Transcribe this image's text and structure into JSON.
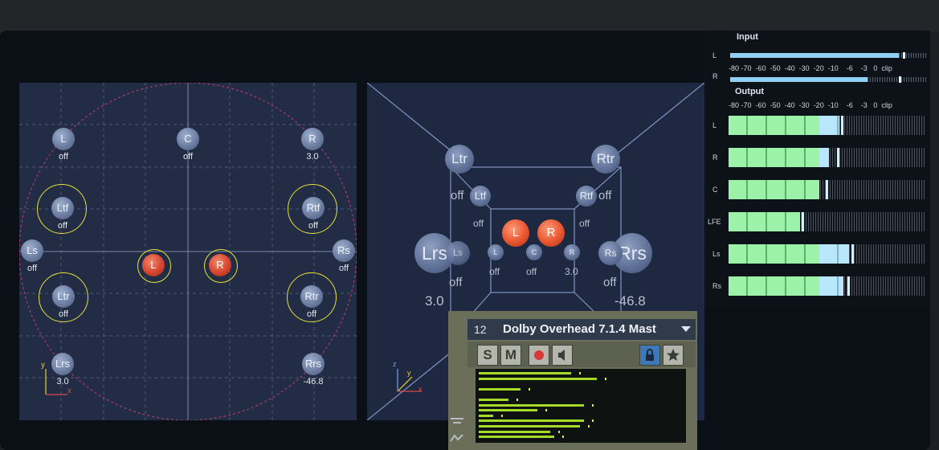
{
  "panner2d": {
    "speakers": [
      {
        "id": "L",
        "label": "L",
        "value": "off"
      },
      {
        "id": "C",
        "label": "C",
        "value": "off"
      },
      {
        "id": "R",
        "label": "R",
        "value": "3.0"
      },
      {
        "id": "Ltf",
        "label": "Ltf",
        "value": "off"
      },
      {
        "id": "Rtf",
        "label": "Rtf",
        "value": "off"
      },
      {
        "id": "Ls",
        "label": "Ls",
        "value": "off"
      },
      {
        "id": "Rs",
        "label": "Rs",
        "value": "off"
      },
      {
        "id": "Ltr",
        "label": "Ltr",
        "value": "off"
      },
      {
        "id": "Rtr",
        "label": "Rtr",
        "value": "off"
      },
      {
        "id": "Lrs",
        "label": "Lrs",
        "value": "3.0"
      },
      {
        "id": "Rrs",
        "label": "Rrs",
        "value": "-46.8"
      }
    ],
    "sources": [
      {
        "id": "L",
        "label": "L"
      },
      {
        "id": "R",
        "label": "R"
      }
    ],
    "axes": {
      "y": "y",
      "x": "x"
    }
  },
  "room3d": {
    "top_speakers": [
      {
        "label": "Ltr"
      },
      {
        "label": "Rtr"
      },
      {
        "label": "Ltf"
      },
      {
        "label": "Rtf"
      }
    ],
    "side_speakers": [
      {
        "label": "Lrs"
      },
      {
        "label": "Rrs"
      },
      {
        "label": "Ls"
      },
      {
        "label": "Rs"
      }
    ],
    "front_speakers": [
      {
        "label": "L"
      },
      {
        "label": "C"
      },
      {
        "label": "R"
      }
    ],
    "sources": [
      {
        "label": "L"
      },
      {
        "label": "R"
      }
    ],
    "values": {
      "ltr_off": "off",
      "ltf_off": "off",
      "rtf_off": "off",
      "rtr_off": "off",
      "ls_off": "off",
      "rs_off": "off",
      "l_off": "off",
      "c_off": "off",
      "r_val": "3.0",
      "lrs_val": "3.0",
      "rrs_val": "-46.8"
    },
    "axes": {
      "z": "z",
      "y": "y",
      "x": "x"
    }
  },
  "meters": {
    "input_title": "Input",
    "output_title": "Output",
    "scale": [
      "-80",
      "-70",
      "-60",
      "-50",
      "-40",
      "-30",
      "-20",
      "-10",
      "-6",
      "-3",
      "0",
      "clip"
    ],
    "input_channels": [
      {
        "label": "L",
        "level": 0.86,
        "peak": 0.88
      },
      {
        "label": "R",
        "level": 0.7,
        "peak": 0.86
      }
    ],
    "output_channels": [
      {
        "label": "L",
        "green": 0.46,
        "blue": 0.1,
        "peak": 0.57
      },
      {
        "label": "R",
        "green": 0.46,
        "blue": 0.05,
        "peak": 0.55
      },
      {
        "label": "C",
        "green": 0.46,
        "blue": 0.0,
        "peak": 0.49
      },
      {
        "label": "LFE",
        "green": 0.36,
        "blue": 0.0,
        "peak": 0.37
      },
      {
        "label": "Ls",
        "green": 0.46,
        "blue": 0.15,
        "peak": 0.62
      },
      {
        "label": "Rs",
        "green": 0.46,
        "blue": 0.12,
        "peak": 0.6
      }
    ]
  },
  "channel_strip": {
    "number": "12",
    "name": "Dolby Overhead 7.1.4 Mast",
    "buttons": {
      "solo": "S",
      "mute": "M"
    },
    "colors": {
      "record": "#d83a3a",
      "lock_bg": "#3f78b8"
    },
    "icons": [
      "record-icon",
      "speaker-icon",
      "lock-icon",
      "star-icon"
    ],
    "mini_meter_levels": [
      0.44,
      0.56,
      0.0,
      0.2,
      0.0,
      0.14,
      0.5,
      0.28,
      0.07,
      0.5,
      0.48,
      0.34,
      0.36
    ]
  }
}
